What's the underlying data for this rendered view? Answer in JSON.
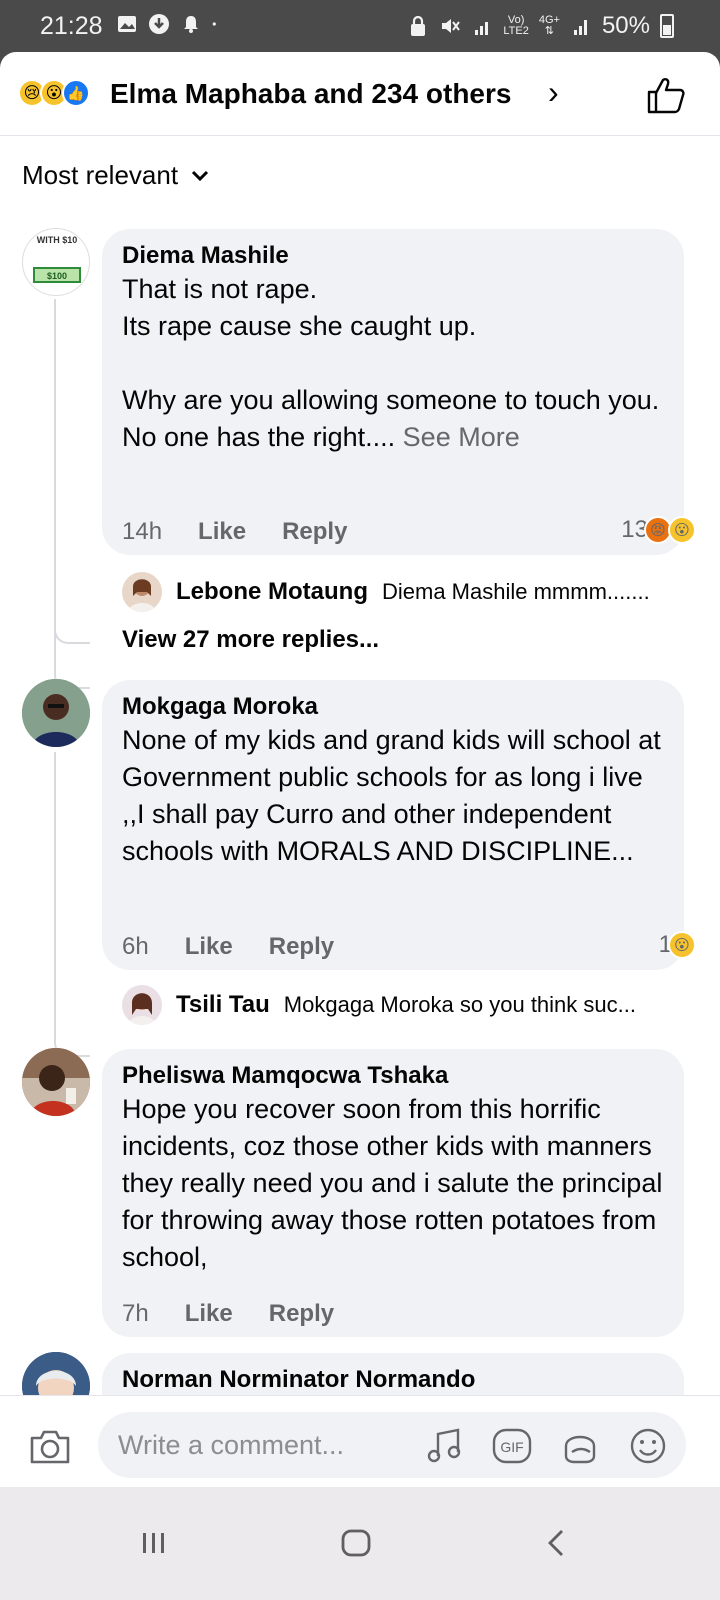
{
  "status_bar": {
    "time": "21:28",
    "network_top": "Vo)",
    "network_bottom": "LTE2",
    "network_type": "4G+",
    "battery": "50%"
  },
  "header": {
    "reactions": [
      "sad",
      "wow",
      "like"
    ],
    "title": "Elma Maphaba and 234 others"
  },
  "sort": {
    "label": "Most relevant"
  },
  "comments": [
    {
      "author": "Diema Mashile",
      "avatar_caption": "WITH $10",
      "avatar_bill": "$100",
      "text": "That is not rape.\nIts rape cause she caught up.\n\nWhy are you allowing someone to touch you.\nNo one has the right.... ",
      "see_more": "See More",
      "time": "14h",
      "like": "Like",
      "reply": "Reply",
      "reaction_count": "13",
      "reactions": [
        "angry",
        "wow"
      ],
      "reply_preview": {
        "author": "Lebone Motaung",
        "text": "Diema Mashile mmmm......."
      },
      "view_more": "View 27 more replies..."
    },
    {
      "author": "Mokgaga Moroka",
      "text": "None of my kids and grand kids will school at Government public schools for as  long i live ,,I shall pay Curro and other independent schools with MORALS AND DISCIPLINE...",
      "time": "6h",
      "like": "Like",
      "reply": "Reply",
      "reaction_count": "1",
      "reactions": [
        "wow"
      ],
      "reply_preview": {
        "author": "Tsili Tau",
        "text": "Mokgaga Moroka so you think suc..."
      }
    },
    {
      "author": "Pheliswa Mamqocwa Tshaka",
      "text": "Hope you recover soon from this horrific incidents, coz those other kids with manners they really need you and i salute the principal for throwing away those rotten potatoes from school,",
      "time": "7h",
      "like": "Like",
      "reply": "Reply"
    },
    {
      "author": "Norman Norminator Normando"
    }
  ],
  "composer": {
    "placeholder": "Write a comment..."
  },
  "colors": {
    "accent": "#1877f2",
    "bubble": "#f0f2f5",
    "secondary_text": "#65676b"
  }
}
